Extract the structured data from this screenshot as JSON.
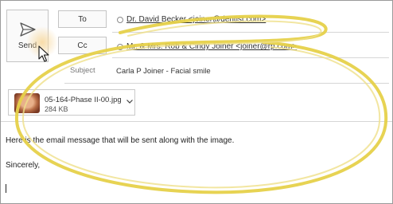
{
  "compose": {
    "send_label": "Send",
    "to_label": "To",
    "cc_label": "Cc",
    "to_recipient": "Dr. David Becker <joiner@dentist.com>",
    "cc_recipient": "Mr. & Mrs. Rob & Cindy Joiner <joiner@rp.com>",
    "subject_label": "Subject",
    "subject_value": "Carla P Joiner - Facial smile"
  },
  "attachment": {
    "name": "05-164-Phase II-00.jpg",
    "size": "284 KB",
    "icon": "chevron-down-icon"
  },
  "message": {
    "line1": "Here is the email message that will be sent along with the image.",
    "line2": "Sincerely,"
  },
  "colors": {
    "highlight": "#e6d14a",
    "send_hover_glow": "#f5d9a0"
  }
}
